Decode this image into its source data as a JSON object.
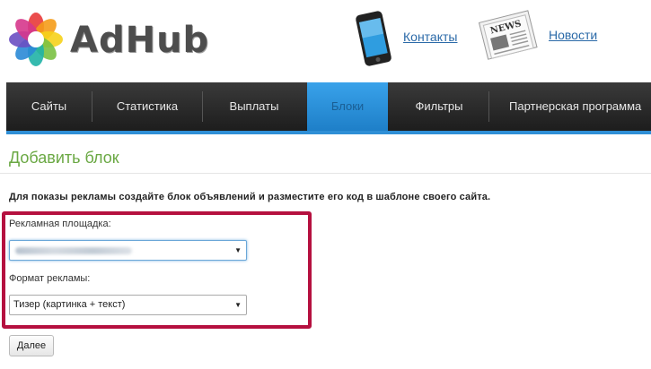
{
  "header": {
    "logo_text": "AdHub",
    "contacts_link": "Контакты",
    "news_link": "Новости",
    "news_icon_caption": "NEWS"
  },
  "nav": {
    "items": [
      {
        "label": "Сайты"
      },
      {
        "label": "Статистика"
      },
      {
        "label": "Выплаты"
      },
      {
        "label": "Блоки",
        "active": true
      },
      {
        "label": "Фильтры"
      },
      {
        "label": "Партнерская программа"
      }
    ]
  },
  "main": {
    "title": "Добавить блок",
    "instructions": "Для показы рекламы создайте блок объявлений и разместите его код в шаблоне своего сайта.",
    "platform_label": "Рекламная площадка:",
    "platform_value": "",
    "format_label": "Формат рекламы:",
    "format_value": "Тизер (картинка + текст)",
    "next_button": "Далее"
  },
  "colors": {
    "accent_blue": "#2f8fd6",
    "title_green": "#6aa843",
    "highlight_red": "#b5103f",
    "link_blue": "#2b6aa8",
    "nav_dark": "#2a2a2a"
  },
  "icons": [
    "adhub-logo-icon",
    "phone-icon",
    "newspaper-icon",
    "chevron-down-icon"
  ]
}
